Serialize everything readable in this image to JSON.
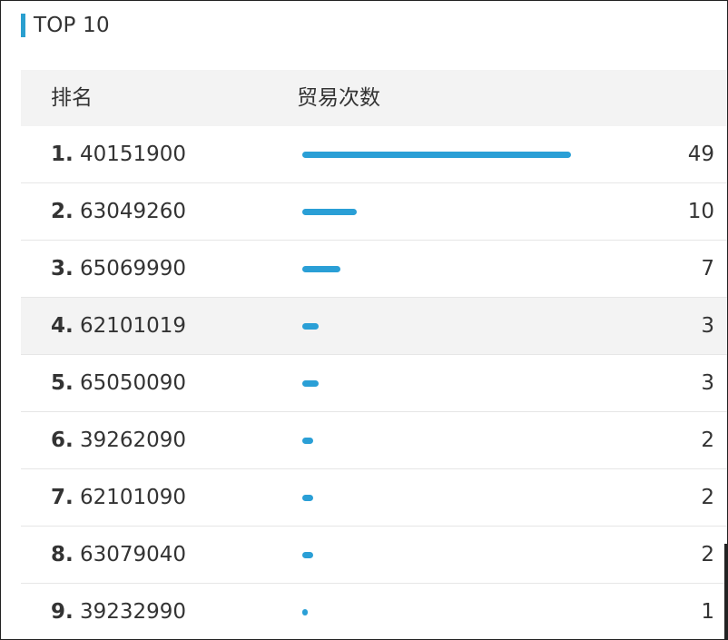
{
  "title": "TOP 10",
  "accent_color": "#2a9fd6",
  "table": {
    "headers": {
      "rank": "排名",
      "count": "贸易次数"
    },
    "max_value": 49,
    "rows": [
      {
        "rank": "1.",
        "code": "40151900",
        "value": 49,
        "value_label": "49"
      },
      {
        "rank": "2.",
        "code": "63049260",
        "value": 10,
        "value_label": "10"
      },
      {
        "rank": "3.",
        "code": "65069990",
        "value": 7,
        "value_label": "7"
      },
      {
        "rank": "4.",
        "code": "62101019",
        "value": 3,
        "value_label": "3"
      },
      {
        "rank": "5.",
        "code": "65050090",
        "value": 3,
        "value_label": "3"
      },
      {
        "rank": "6.",
        "code": "39262090",
        "value": 2,
        "value_label": "2"
      },
      {
        "rank": "7.",
        "code": "62101090",
        "value": 2,
        "value_label": "2"
      },
      {
        "rank": "8.",
        "code": "63079040",
        "value": 2,
        "value_label": "2"
      },
      {
        "rank": "9.",
        "code": "39232990",
        "value": 1,
        "value_label": "1"
      }
    ]
  }
}
